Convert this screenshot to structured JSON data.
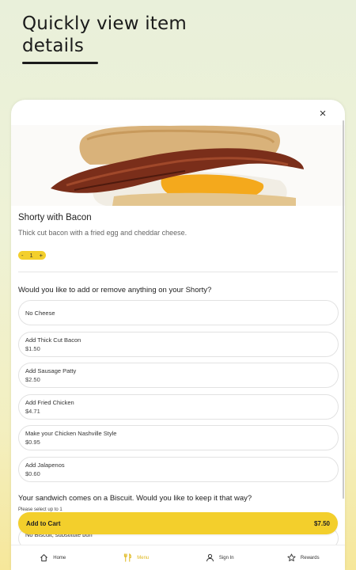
{
  "promo": {
    "title_line1": "Quickly view item",
    "title_line2": "details"
  },
  "sheet": {
    "close_icon": "×",
    "item": {
      "name": "Shorty with Bacon",
      "description": "Thick cut bacon with a fried egg and cheddar cheese.",
      "quantity": "1",
      "minus": "-",
      "plus": "+"
    },
    "question1": "Would you like to add or remove anything on your Shorty?",
    "options": [
      {
        "label": "No Cheese",
        "price": ""
      },
      {
        "label": "Add Thick Cut Bacon",
        "price": "$1.50"
      },
      {
        "label": "Add Sausage Patty",
        "price": "$2.50"
      },
      {
        "label": "Add Fried Chicken",
        "price": "$4.71"
      },
      {
        "label": "Make your Chicken Nashville Style",
        "price": "$0.95"
      },
      {
        "label": "Add Jalapenos",
        "price": "$0.60"
      }
    ],
    "question2": "Your sandwich comes on a Biscuit. Would you like to keep it that way?",
    "question2_sub": "Please select up to 1",
    "option_partial": "No Biscuit, substitute bun"
  },
  "cart": {
    "label": "Add to Cart",
    "total": "$7.50"
  },
  "nav": {
    "items": [
      {
        "label": "Home",
        "icon": "home-icon"
      },
      {
        "label": "Menu",
        "icon": "fork-knife-icon"
      },
      {
        "label": "Sign In",
        "icon": "person-icon"
      },
      {
        "label": "Rewards",
        "icon": "star-icon"
      }
    ]
  },
  "colors": {
    "accent": "#f3cf2c",
    "active_nav": "#e0b81c"
  }
}
